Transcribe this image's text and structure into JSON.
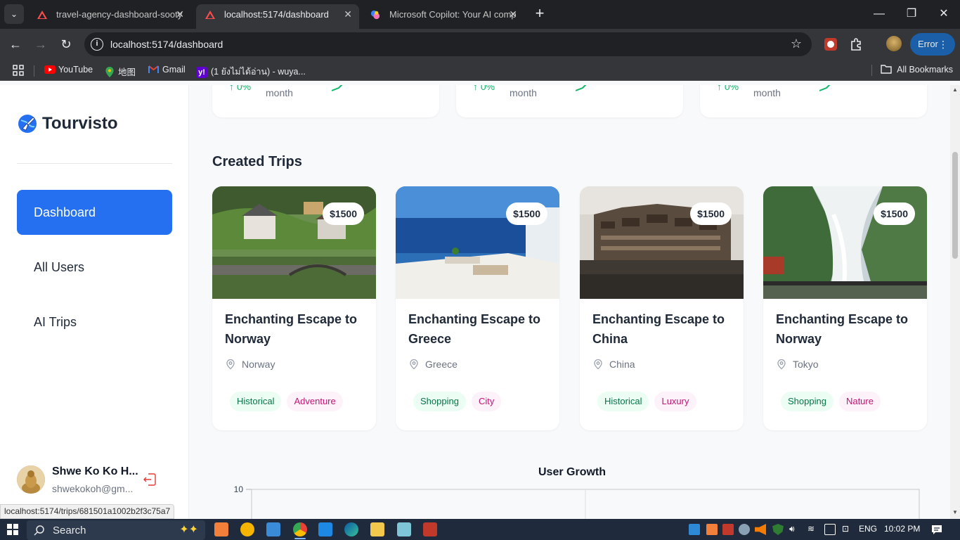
{
  "browser": {
    "tabs": [
      {
        "title": "travel-agency-dashboard-sooty",
        "active": false
      },
      {
        "title": "localhost:5174/dashboard",
        "active": true
      },
      {
        "title": "Microsoft Copilot: Your AI comp",
        "active": false
      }
    ],
    "url": "localhost:5174/dashboard",
    "profile_status": "Error",
    "bookmarks": [
      "YouTube",
      "地图",
      "Gmail",
      "(1 ยังไม่ได้อ่าน) - wuya..."
    ],
    "all_bookmarks_label": "All Bookmarks"
  },
  "sidebar": {
    "brand": "Tourvisto",
    "nav": [
      {
        "label": "Dashboard",
        "active": true
      },
      {
        "label": "All Users",
        "active": false
      },
      {
        "label": "AI Trips",
        "active": false
      }
    ],
    "user": {
      "name": "Shwe Ko Ko H...",
      "email": "shwekokoh@gm..."
    }
  },
  "stats": [
    {
      "change": "0%",
      "period": "month"
    },
    {
      "change": "0%",
      "period": "month"
    },
    {
      "change": "0%",
      "period": "month"
    }
  ],
  "created_trips": {
    "title": "Created Trips",
    "trips": [
      {
        "price": "$1500",
        "title": "Enchanting Escape to Norway",
        "location": "Norway",
        "tags": [
          "Historical",
          "Adventure"
        ]
      },
      {
        "price": "$1500",
        "title": "Enchanting Escape to Greece",
        "location": "Greece",
        "tags": [
          "Shopping",
          "City"
        ]
      },
      {
        "price": "$1500",
        "title": "Enchanting Escape to China",
        "location": "China",
        "tags": [
          "Historical",
          "Luxury"
        ]
      },
      {
        "price": "$1500",
        "title": "Enchanting Escape to Norway",
        "location": "Tokyo",
        "tags": [
          "Shopping",
          "Nature"
        ]
      }
    ]
  },
  "user_growth": {
    "title": "User Growth",
    "y_tick": "10"
  },
  "status_bar_url": "localhost:5174/trips/681501a1002b2f3c75a7",
  "taskbar": {
    "search_label": "Search",
    "language": "ENG",
    "time": "10:02 PM"
  },
  "colors": {
    "primary": "#256ff1",
    "positive": "#12b76a",
    "chip_green_bg": "#ecfdf3",
    "chip_pink_bg": "#fdf2fa"
  }
}
